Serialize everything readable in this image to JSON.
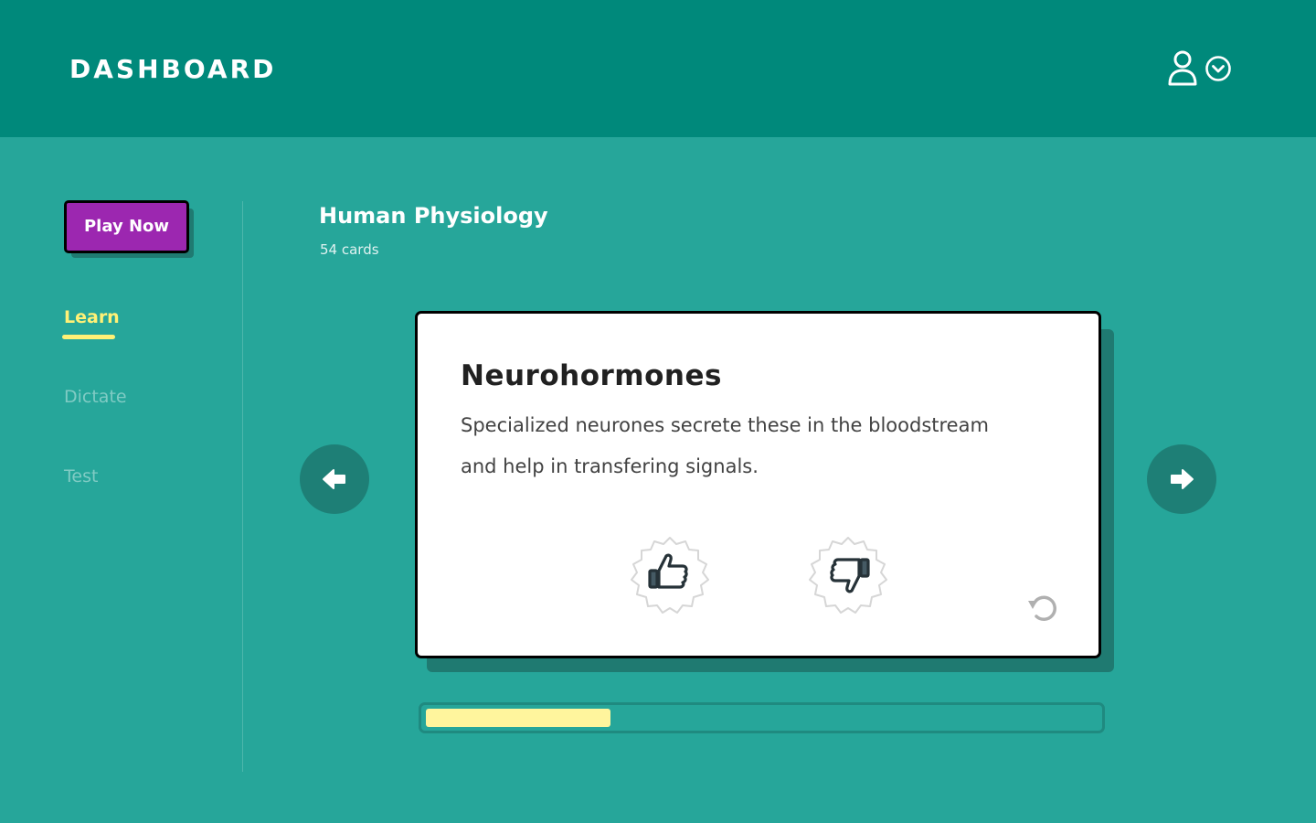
{
  "header": {
    "title": "DASHBOARD",
    "icons": [
      "user-icon",
      "chevron-down-circle-icon"
    ]
  },
  "sidebar": {
    "play_button": "Play Now",
    "items": [
      {
        "label": "Learn",
        "active": true
      },
      {
        "label": "Dictate",
        "active": false
      },
      {
        "label": "Test",
        "active": false
      }
    ]
  },
  "deck": {
    "title": "Human Physiology",
    "count": "54 cards"
  },
  "card": {
    "term": "Neurohormones",
    "definition": "Specialized neurones secrete these in the bloodstream and help in transfering signals."
  },
  "progress": {
    "fraction": 0.275
  },
  "colors": {
    "header_bg": "#00897b",
    "page_bg": "#26a69a",
    "play_button": "#9c27b0",
    "active_nav": "#fff176",
    "progress_fill": "#fff59d"
  }
}
